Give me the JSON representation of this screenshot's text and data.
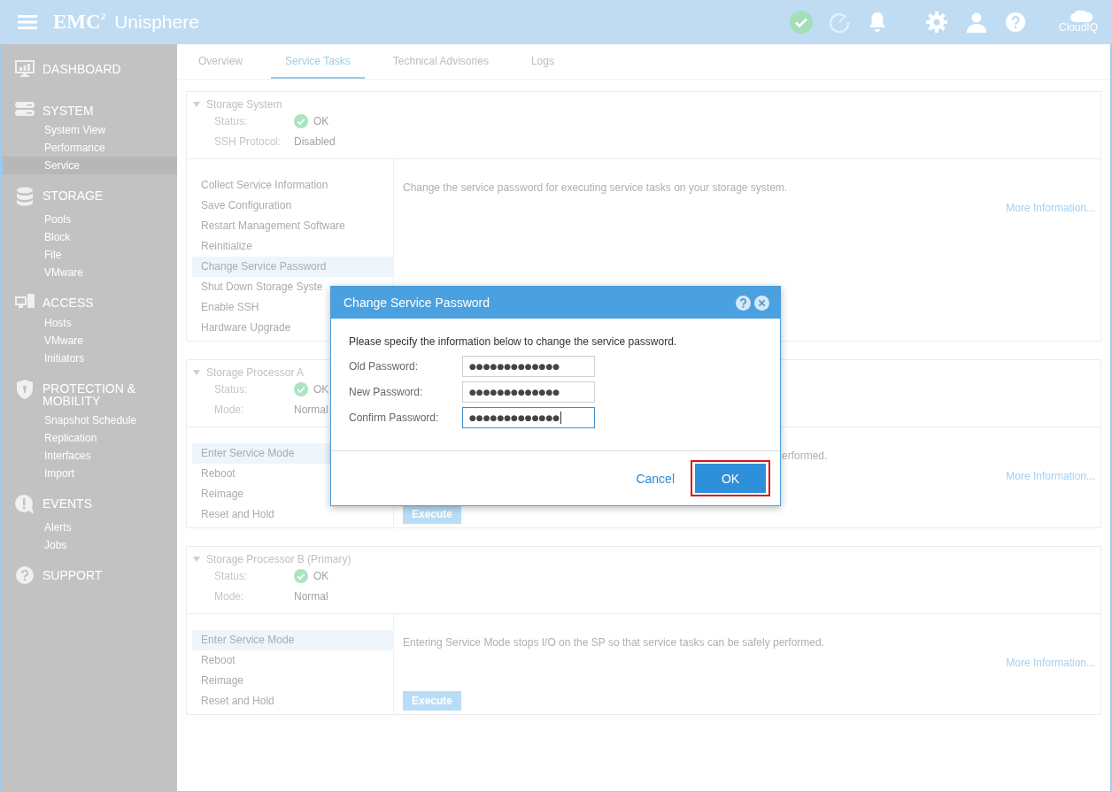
{
  "header": {
    "logo": "EMC$^{2}$",
    "app_name": "Unisphere",
    "cloud_label": "CloudIQ"
  },
  "sidebar": {
    "sections": [
      {
        "label": "DASHBOARD"
      },
      {
        "label": "SYSTEM",
        "items": [
          {
            "label": "System View",
            "selected": false
          },
          {
            "label": "Performance",
            "selected": false
          },
          {
            "label": "Service",
            "selected": true
          }
        ]
      },
      {
        "label": "STORAGE",
        "items": [
          {
            "label": "Pools",
            "selected": false
          },
          {
            "label": "Block",
            "selected": false
          },
          {
            "label": "File",
            "selected": false
          },
          {
            "label": "VMware",
            "selected": false
          }
        ]
      },
      {
        "label": "ACCESS",
        "items": [
          {
            "label": "Hosts",
            "selected": false
          },
          {
            "label": "VMware",
            "selected": false
          },
          {
            "label": "Initiators",
            "selected": false
          }
        ]
      },
      {
        "label": "PROTECTION & MOBILITY",
        "items": [
          {
            "label": "Snapshot Schedule",
            "selected": false
          },
          {
            "label": "Replication",
            "selected": false
          },
          {
            "label": "Interfaces",
            "selected": false
          },
          {
            "label": "Import",
            "selected": false
          }
        ]
      },
      {
        "label": "EVENTS",
        "items": [
          {
            "label": "Alerts",
            "selected": false
          },
          {
            "label": "Jobs",
            "selected": false
          }
        ]
      },
      {
        "label": "SUPPORT"
      }
    ]
  },
  "tabs": [
    {
      "label": "Overview",
      "selected": false
    },
    {
      "label": "Service Tasks",
      "selected": true
    },
    {
      "label": "Technical Advisories",
      "selected": false
    },
    {
      "label": "Logs",
      "selected": false
    }
  ],
  "panels": [
    {
      "title": "Storage System",
      "expanded": true,
      "fields": [
        {
          "label": "Status:",
          "value": "OK",
          "kind": "status"
        },
        {
          "label": "SSH Protocol:",
          "value": "Disabled",
          "kind": "text"
        }
      ],
      "tasks": [
        {
          "label": "Collect Service Information",
          "selected": false
        },
        {
          "label": "Save Configuration",
          "selected": false
        },
        {
          "label": "Restart Management Software",
          "selected": false
        },
        {
          "label": "Reinitialize",
          "selected": false
        },
        {
          "label": "Change Service Password",
          "selected": true
        },
        {
          "label": "Shut Down Storage Syste",
          "selected": false
        },
        {
          "label": "Enable SSH",
          "selected": false
        },
        {
          "label": "Hardware Upgrade",
          "selected": false
        }
      ],
      "description": "Change the service password for executing service tasks on your storage system.",
      "more_info": "More Information..."
    },
    {
      "title": "Storage Processor A",
      "expanded": true,
      "fields": [
        {
          "label": "Status:",
          "value": "OK",
          "kind": "status"
        },
        {
          "label": "Mode:",
          "value": "Normal",
          "kind": "text"
        }
      ],
      "tasks": [
        {
          "label": "Enter Service Mode",
          "selected": true
        },
        {
          "label": "Reboot",
          "selected": false
        },
        {
          "label": "Reimage",
          "selected": false
        },
        {
          "label": "Reset and Hold",
          "selected": false
        }
      ],
      "description": "erformed.",
      "description_covered": true,
      "more_info": "More Information...",
      "execute_label": "Execute"
    },
    {
      "title": "Storage Processor B (Primary)",
      "expanded": true,
      "fields": [
        {
          "label": "Status:",
          "value": "OK",
          "kind": "status"
        },
        {
          "label": "Mode:",
          "value": "Normal",
          "kind": "text"
        }
      ],
      "tasks": [
        {
          "label": "Enter Service Mode",
          "selected": true
        },
        {
          "label": "Reboot",
          "selected": false
        },
        {
          "label": "Reimage",
          "selected": false
        },
        {
          "label": "Reset and Hold",
          "selected": false
        }
      ],
      "description": "Entering Service Mode stops I/O on the SP so that service tasks can be safely performed.",
      "more_info": "More Information...",
      "execute_label": "Execute"
    }
  ],
  "dialog": {
    "title": "Change Service Password",
    "instruction": "Please specify the information below to change the service password.",
    "fields": [
      {
        "label": "Old Password:",
        "value": "●●●●●●●●●●●●●",
        "focused": false
      },
      {
        "label": "New Password:",
        "value": "●●●●●●●●●●●●●",
        "focused": false
      },
      {
        "label": "Confirm Password:",
        "value": "●●●●●●●●●●●●●",
        "focused": true
      }
    ],
    "cancel_label": "Cancel",
    "ok_button": {
      "label": "OK",
      "highlighted": true
    }
  }
}
